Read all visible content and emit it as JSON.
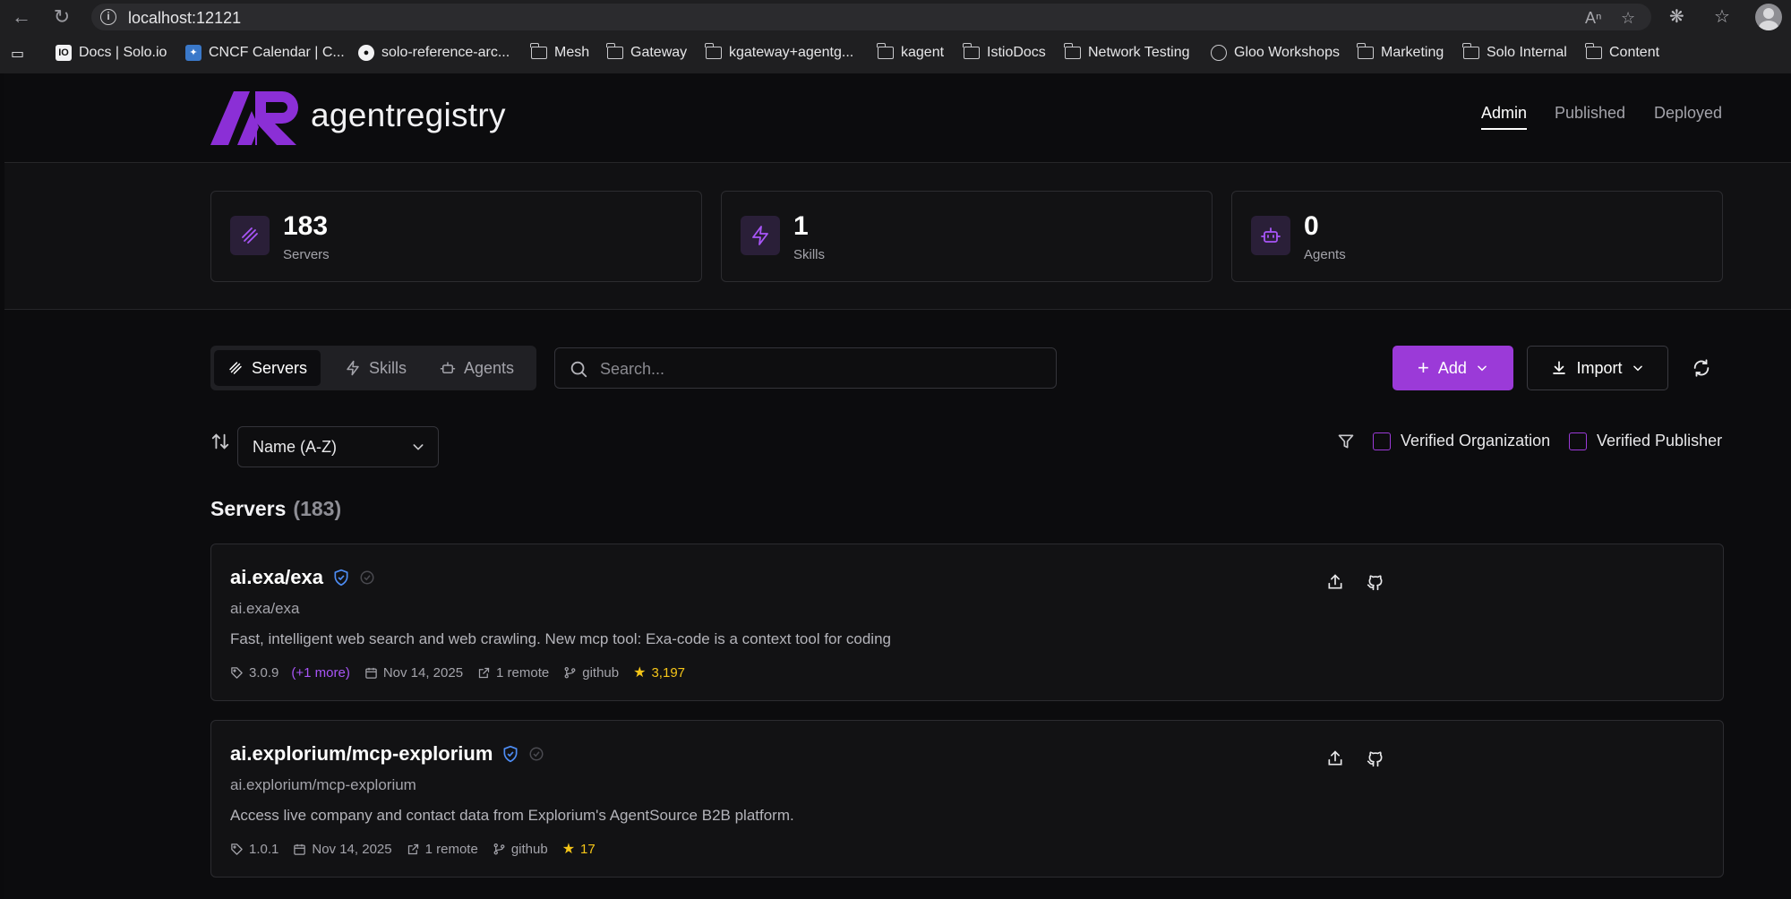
{
  "browser": {
    "url": "localhost:12121",
    "bookmarks": [
      {
        "label": "Docs | Solo.io",
        "type": "site",
        "icon": "solo-icon"
      },
      {
        "label": "CNCF Calendar | C...",
        "type": "site",
        "icon": "cncf-icon"
      },
      {
        "label": "solo-reference-arc...",
        "type": "site",
        "icon": "github-icon"
      },
      {
        "label": "Mesh",
        "type": "folder"
      },
      {
        "label": "Gateway",
        "type": "folder"
      },
      {
        "label": "kgateway+agentg...",
        "type": "folder"
      },
      {
        "label": "kagent",
        "type": "folder"
      },
      {
        "label": "IstioDocs",
        "type": "folder"
      },
      {
        "label": "Network Testing",
        "type": "folder"
      },
      {
        "label": "Gloo Workshops",
        "type": "site",
        "icon": "globe-icon"
      },
      {
        "label": "Marketing",
        "type": "folder"
      },
      {
        "label": "Solo Internal",
        "type": "folder"
      },
      {
        "label": "Content",
        "type": "folder"
      }
    ]
  },
  "app": {
    "logo_text": "agentregistry",
    "nav": [
      {
        "label": "Admin",
        "active": true
      },
      {
        "label": "Published",
        "active": false
      },
      {
        "label": "Deployed",
        "active": false
      }
    ],
    "stats": [
      {
        "value": "183",
        "label": "Servers",
        "icon": "server-icon"
      },
      {
        "value": "1",
        "label": "Skills",
        "icon": "lightning-icon"
      },
      {
        "value": "0",
        "label": "Agents",
        "icon": "robot-icon"
      }
    ],
    "tabs": [
      {
        "label": "Servers",
        "active": true
      },
      {
        "label": "Skills",
        "active": false
      },
      {
        "label": "Agents",
        "active": false
      }
    ],
    "search_placeholder": "Search...",
    "add_label": "Add",
    "import_label": "Import",
    "sort_value": "Name (A-Z)",
    "filters": [
      {
        "label": "Verified Organization",
        "checked": false
      },
      {
        "label": "Verified Publisher",
        "checked": false
      }
    ],
    "section_title": "Servers",
    "section_count": "(183)",
    "accent_color": "#9b3ad8",
    "servers": [
      {
        "name": "ai.exa/exa",
        "id": "ai.exa/exa",
        "description": "Fast, intelligent web search and web crawling. New mcp tool: Exa-code is a context tool for coding",
        "version": "3.0.9",
        "more": "(+1 more)",
        "date": "Nov 14, 2025",
        "remotes": "1 remote",
        "source": "github",
        "stars": "3,197"
      },
      {
        "name": "ai.explorium/mcp-explorium",
        "id": "ai.explorium/mcp-explorium",
        "description": "Access live company and contact data from Explorium's AgentSource B2B platform.",
        "version": "1.0.1",
        "more": "",
        "date": "Nov 14, 2025",
        "remotes": "1 remote",
        "source": "github",
        "stars": "17"
      }
    ]
  }
}
